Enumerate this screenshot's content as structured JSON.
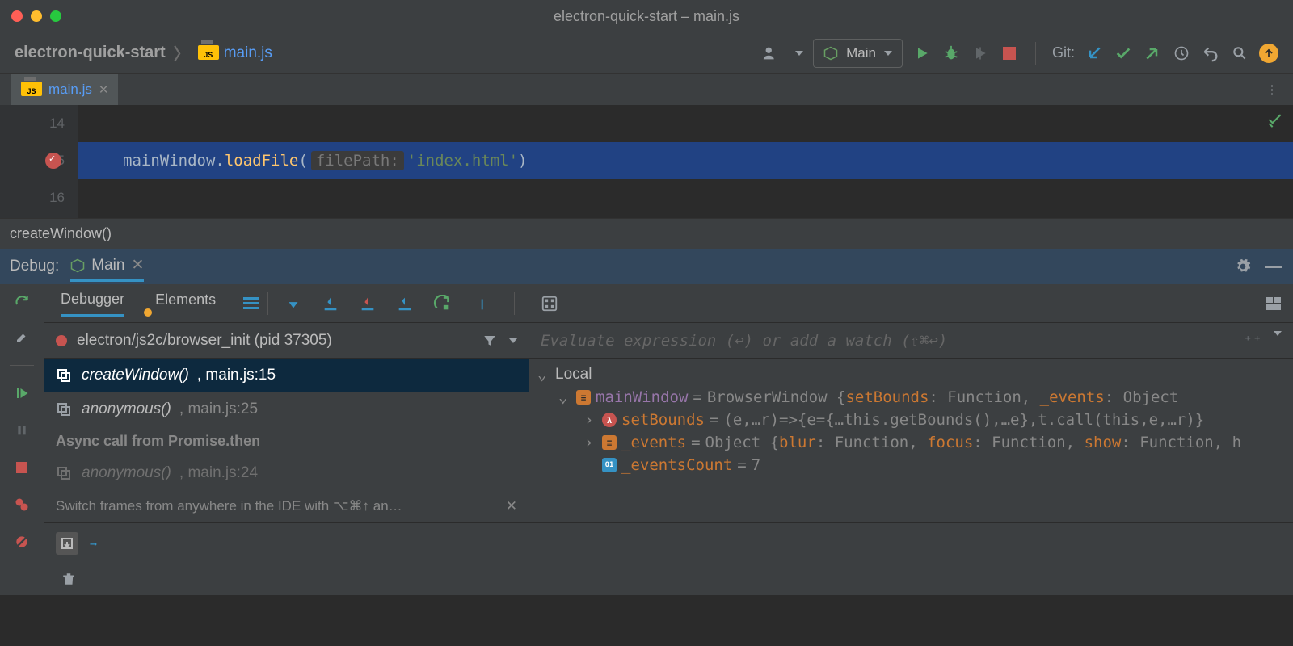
{
  "window": {
    "title": "electron-quick-start – main.js"
  },
  "breadcrumb": {
    "project": "electron-quick-start",
    "file": "main.js"
  },
  "run_config": {
    "name": "Main"
  },
  "git": {
    "label": "Git:"
  },
  "editor": {
    "tab": "main.js",
    "gutter": [
      "14",
      "15",
      "16"
    ],
    "line15": {
      "object": "mainWindow",
      "method": "loadFile",
      "hint": "filePath:",
      "string": "'index.html'"
    },
    "context": "createWindow()"
  },
  "debug": {
    "panel_label": "Debug:",
    "session": "Main",
    "tabs": {
      "debugger": "Debugger",
      "elements": "Elements"
    },
    "thread": "electron/js2c/browser_init (pid 37305)",
    "frames": [
      {
        "fn": "createWindow()",
        "loc": ", main.js:15"
      },
      {
        "fn": "anonymous()",
        "loc": ", main.js:25"
      }
    ],
    "async_label": "Async call from Promise.then",
    "frames_after": [
      {
        "fn": "anonymous()",
        "loc": ", main.js:24"
      }
    ],
    "tip": "Switch frames from anywhere in the IDE with ⌥⌘↑ an…",
    "eval_placeholder": "Evaluate expression (↩) or add a watch (⇧⌘↩)",
    "vars": {
      "scope": "Local",
      "mainWindow": {
        "name": "mainWindow",
        "summary": "BrowserWindow {",
        "k1": "setBounds",
        "v1": ": Function, ",
        "k2": "_events",
        "v2": ": Object"
      },
      "setBounds": {
        "name": "setBounds",
        "val": "(e,…r)=>{e={…this.getBounds(),…e},t.call(this,e,…r)}"
      },
      "events": {
        "name": "_events",
        "summary": "Object {",
        "k1": "blur",
        "v1": ": Function, ",
        "k2": "focus",
        "v2": ": Function, ",
        "k3": "show",
        "v3": ": Function, h"
      },
      "eventsCount": {
        "name": "_eventsCount",
        "val": "7"
      }
    },
    "console_prompt": "→"
  }
}
